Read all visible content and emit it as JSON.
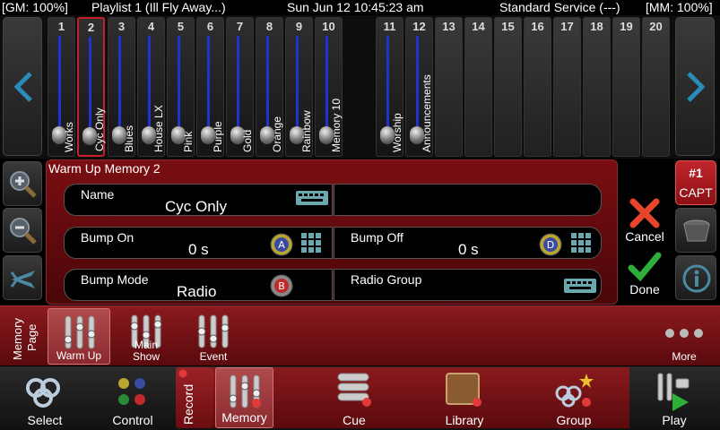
{
  "status": {
    "gm": "[GM: 100%]",
    "playlist": "Playlist 1 (Ill Fly Away...)",
    "datetime": "Sun Jun 12 10:45:23 am",
    "service": "Standard Service (---)",
    "mm": "[MM: 100%]"
  },
  "faders": [
    {
      "num": "1",
      "label": "Works"
    },
    {
      "num": "2",
      "label": "Cyc Only"
    },
    {
      "num": "3",
      "label": "Blues"
    },
    {
      "num": "4",
      "label": "House LX"
    },
    {
      "num": "5",
      "label": "Pink"
    },
    {
      "num": "6",
      "label": "Purple"
    },
    {
      "num": "7",
      "label": "Gold"
    },
    {
      "num": "8",
      "label": "Orange"
    },
    {
      "num": "9",
      "label": "Rainbow"
    },
    {
      "num": "10",
      "label": "Memory 10"
    },
    {
      "num": "11",
      "label": "Worship"
    },
    {
      "num": "12",
      "label": "Announcements"
    },
    {
      "num": "13",
      "label": ""
    },
    {
      "num": "14",
      "label": ""
    },
    {
      "num": "15",
      "label": ""
    },
    {
      "num": "16",
      "label": ""
    },
    {
      "num": "17",
      "label": ""
    },
    {
      "num": "18",
      "label": ""
    },
    {
      "num": "19",
      "label": ""
    },
    {
      "num": "20",
      "label": ""
    }
  ],
  "dialog": {
    "title": "Warm Up Memory 2",
    "name_label": "Name",
    "name_value": "Cyc Only",
    "bump_on_label": "Bump On",
    "bump_on_value": "0 s",
    "bump_off_label": "Bump Off",
    "bump_off_value": "0 s",
    "bump_mode_label": "Bump Mode",
    "bump_mode_value": "Radio",
    "radio_group_label": "Radio Group",
    "cancel": "Cancel",
    "done": "Done"
  },
  "capture": {
    "line1": "#1",
    "line2": "CAPT"
  },
  "memory_page": {
    "label_line1": "Memory",
    "label_line2": "Page",
    "pages": [
      "Warm Up",
      "Main\nShow",
      "Event"
    ],
    "more": "More"
  },
  "toolbar": {
    "select": "Select",
    "control": "Control",
    "record": "Record",
    "memory": "Memory",
    "cue": "Cue",
    "library": "Library",
    "group": "Group",
    "play": "Play"
  },
  "colors": {
    "accent_red": "#8a1a1e",
    "fader_track": "#2233cc",
    "cancel_x": "#e8462a",
    "done_check": "#2fae3a"
  }
}
